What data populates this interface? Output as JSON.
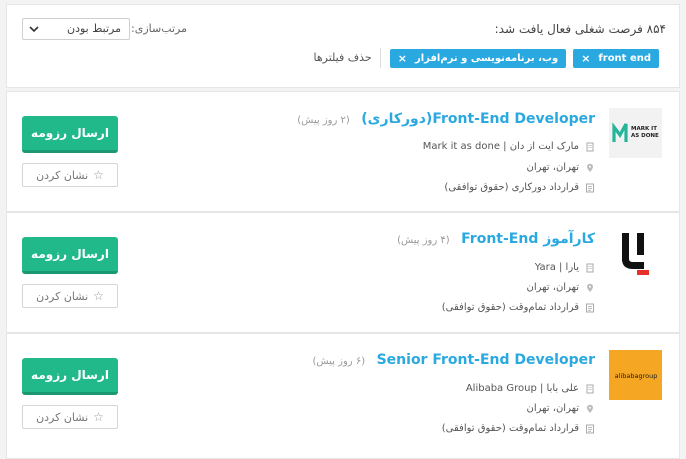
{
  "header": {
    "count_text": "۸۵۴ فرصت شغلی فعال یافت شد:",
    "sort_label": "مرتب‌سازی:",
    "sort_value": "مرتبط بودن",
    "chips": [
      {
        "label": "front end"
      },
      {
        "label": "وب، برنامه‌نویسی و نرم‌افزار"
      }
    ],
    "clear_filters": "حذف فیلترها"
  },
  "jobs": [
    {
      "title": "Front-End Developer(دورکاری)",
      "ago": "(۲ روز پیش)",
      "company": "مارک ایت از دان | Mark it as done",
      "location": "تهران، تهران",
      "contract": "قرارداد دورکاری (حقوق توافقی)",
      "apply_label": "ارسال رزومه",
      "bookmark_label": "نشان کردن",
      "logo_text": "MARK IT AS DONE"
    },
    {
      "title": "کارآموز Front-End",
      "ago": "(۴ روز پیش)",
      "company": "یارا | Yara",
      "location": "تهران، تهران",
      "contract": "قرارداد تمام‌وقت (حقوق توافقی)",
      "apply_label": "ارسال رزومه",
      "bookmark_label": "نشان کردن",
      "logo_text": ""
    },
    {
      "title": "Senior Front-End Developer",
      "ago": "(۶ روز پیش)",
      "company": "علی بابا | Alibaba Group",
      "location": "تهران، تهران",
      "contract": "قرارداد تمام‌وقت (حقوق توافقی)",
      "apply_label": "ارسال رزومه",
      "bookmark_label": "نشان کردن",
      "logo_text": "alibaba group"
    }
  ],
  "colors": {
    "accent_blue": "#2aa9e0",
    "apply_green": "#22b98a"
  }
}
